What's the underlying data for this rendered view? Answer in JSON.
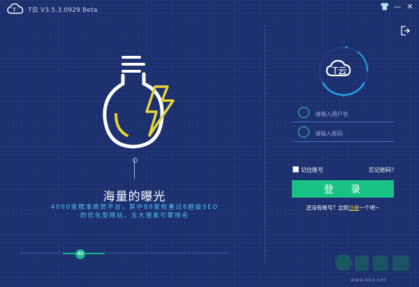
{
  "titlebar": {
    "title": "T云 V3.5.3.0929 Beta",
    "icons": [
      "cloud-logo-icon",
      "shirt-icon",
      "minimize-icon",
      "close-icon"
    ],
    "skin_glyph": "👕",
    "minimize_glyph": "—",
    "close_glyph": "✕"
  },
  "hero": {
    "title": "海量的曝光",
    "description": "4000家精准商贸平台，其中80家权重过6超级SEO的优化型网站，五大搜索引擎排名",
    "step_label": "02",
    "step_index": 2,
    "step_total": 5
  },
  "login": {
    "logo_text": "T云",
    "username_placeholder": "请输入用户名",
    "password_placeholder": "请输入密码",
    "remember_label": "记住账号",
    "forgot_label": "忘记密码？",
    "button_label": "登 录",
    "no_account_text": "还没有账号？立即",
    "register_label": "注册",
    "suffix_text": "一个吧~"
  },
  "watermark": {
    "url": "www.kkx.net"
  },
  "colors": {
    "background": "#1b2f6e",
    "accent_green": "#19c183",
    "accent_cyan": "#52c7ff",
    "accent_yellow": "#f0d23a"
  }
}
